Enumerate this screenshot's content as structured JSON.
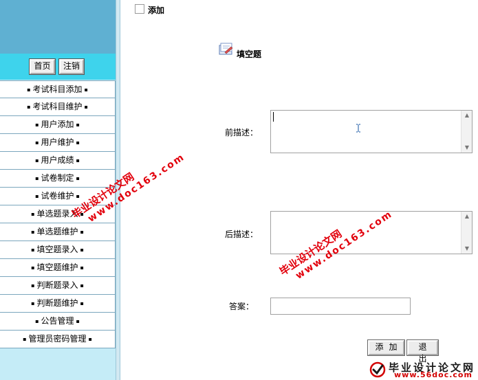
{
  "sidebar": {
    "home_label": "首页",
    "logout_label": "注销",
    "bullet": "▪",
    "items": [
      {
        "label": "考试科目添加"
      },
      {
        "label": "考试科目维护"
      },
      {
        "label": "用户添加"
      },
      {
        "label": "用户维护"
      },
      {
        "label": "用户成绩"
      },
      {
        "label": "试卷制定"
      },
      {
        "label": "试卷维护"
      },
      {
        "label": "单选题录入"
      },
      {
        "label": "单选题维护"
      },
      {
        "label": "填空题录入"
      },
      {
        "label": "填空题维护"
      },
      {
        "label": "判断题录入"
      },
      {
        "label": "判断题维护"
      },
      {
        "label": "公告管理"
      },
      {
        "label": "管理员密码管理"
      }
    ]
  },
  "main": {
    "add_label": "添加",
    "section_title": "填空题",
    "front_label": "前描述：",
    "back_label": "后描述：",
    "answer_label": "答案：",
    "front_value": "",
    "back_value": "",
    "answer_value": "",
    "add_button": "添加",
    "exit_button": "退出"
  },
  "watermark": {
    "cn": "毕业设计论文网",
    "url": "www.doc163.com"
  },
  "logo": {
    "cn": "毕业设计论文网",
    "url": "www.56doc.com"
  },
  "colors": {
    "sidebar_top": "#5fb0d2",
    "sidebar_bar": "#3ed3ec",
    "sidebar_bg": "#c5ecf7",
    "watermark": "#e2000c"
  }
}
